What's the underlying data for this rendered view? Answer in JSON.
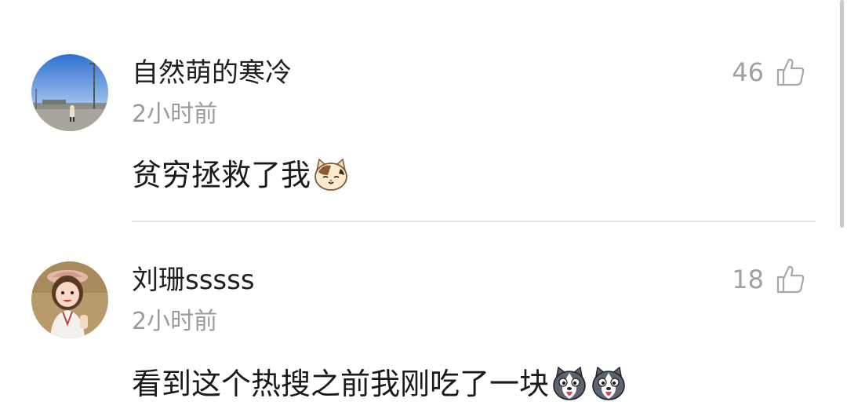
{
  "comments": [
    {
      "username": "自然萌的寒冷",
      "time": "2小时前",
      "text": "贫穷拯救了我",
      "emojis": [
        "cat-face-emoji"
      ],
      "likes": "46",
      "avatar": "landscape-photo-avatar"
    },
    {
      "username": "刘珊sssss",
      "time": "2小时前",
      "text": "看到这个热搜之前我刚吃了一块",
      "emojis": [
        "husky-emoji",
        "husky-emoji"
      ],
      "likes": "18",
      "avatar": "child-photo-avatar"
    }
  ],
  "icons": {
    "like": "thumbs-up-icon"
  },
  "colors": {
    "username": "#1f1f1f",
    "time": "#9b9b9b",
    "likes": "#a0a0a0",
    "divider": "#e6e6e6"
  }
}
